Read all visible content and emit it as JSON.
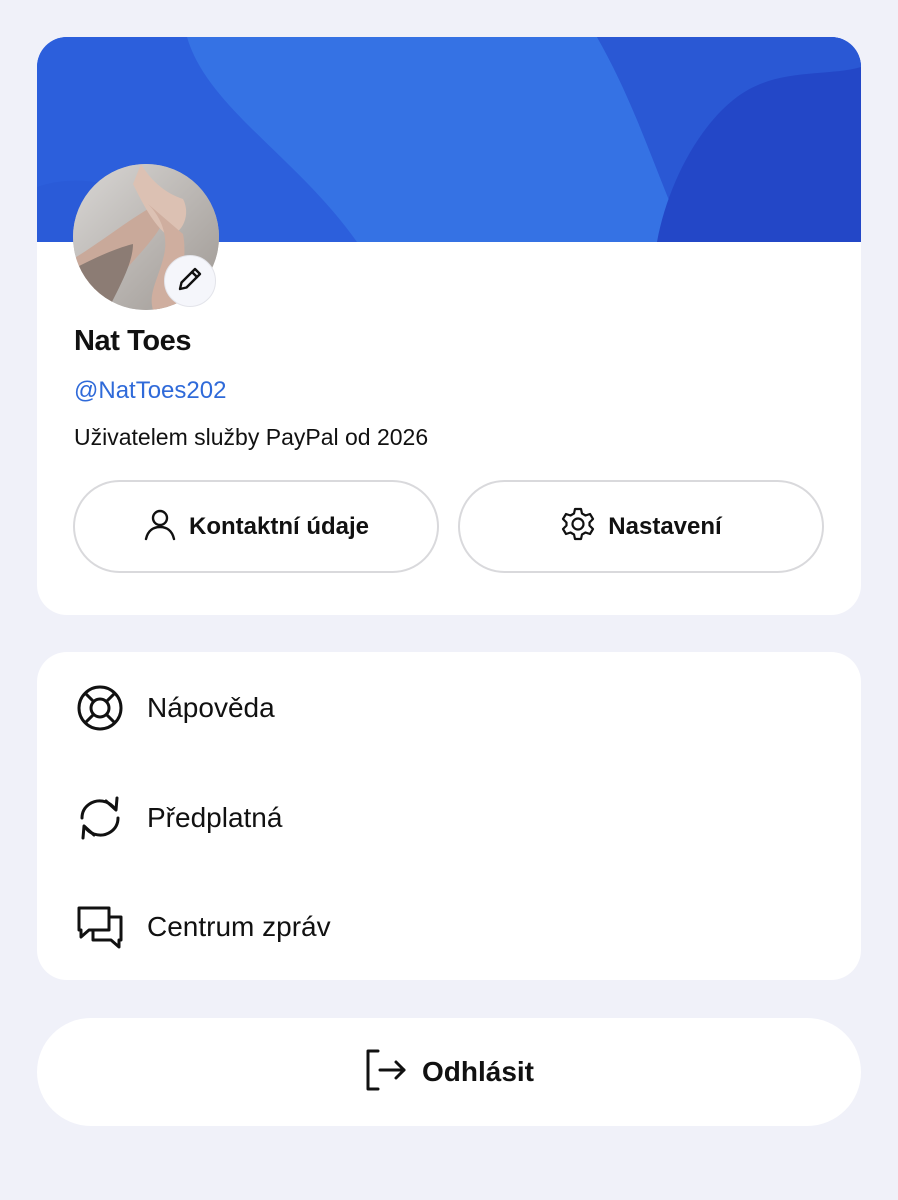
{
  "profile": {
    "name": "Nat Toes",
    "handle": "@NatToes202",
    "member_since": "Uživatelem služby PayPal od 2026"
  },
  "actions": {
    "contact_label": "Kontaktní údaje",
    "settings_label": "Nastavení"
  },
  "menu": {
    "items": [
      {
        "label": "Nápověda",
        "icon": "lifebuoy-icon"
      },
      {
        "label": "Předplatná",
        "icon": "refresh-icon"
      },
      {
        "label": "Centrum zpráv",
        "icon": "chat-bubbles-icon"
      }
    ]
  },
  "logout": {
    "label": "Odhlásit",
    "icon": "logout-icon"
  },
  "colors": {
    "background": "#f0f1f9",
    "banner": "#2d63de",
    "handle": "#2f6ad9",
    "card": "#ffffff"
  }
}
